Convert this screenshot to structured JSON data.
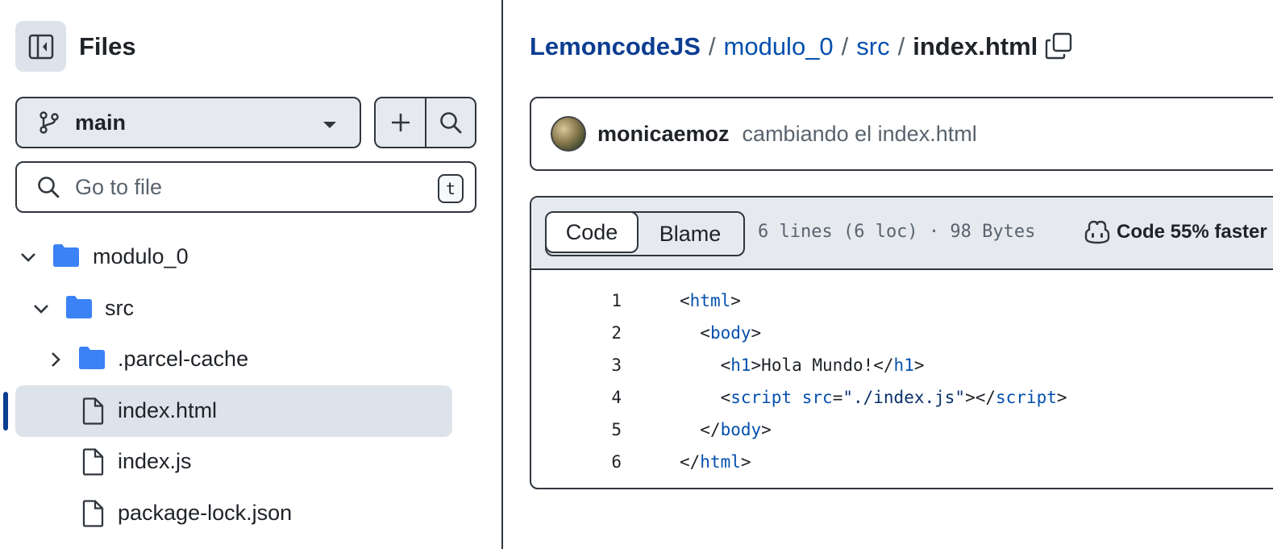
{
  "sidebar": {
    "title": "Files",
    "branch": "main",
    "search_placeholder": "Go to file",
    "search_shortcut": "t",
    "tree": [
      {
        "label": "modulo_0",
        "type": "folder",
        "expanded": true
      },
      {
        "label": "src",
        "type": "folder",
        "expanded": true
      },
      {
        "label": ".parcel-cache",
        "type": "folder",
        "expanded": false
      },
      {
        "label": "index.html",
        "type": "file",
        "active": true
      },
      {
        "label": "index.js",
        "type": "file"
      },
      {
        "label": "package-lock.json",
        "type": "file"
      }
    ]
  },
  "breadcrumb": {
    "repo": "LemoncodeJS",
    "dir1": "modulo_0",
    "dir2": "src",
    "file": "index.html",
    "separator": "/"
  },
  "commit": {
    "author": "monicaemoz",
    "message": "cambiando el index.html"
  },
  "file_header": {
    "tab_code": "Code",
    "tab_blame": "Blame",
    "meta": "6 lines (6 loc) · 98 Bytes",
    "copilot": "Code 55% faster"
  },
  "code_lines": [
    {
      "n": "1",
      "indent": "",
      "parts": [
        [
          "p",
          "<"
        ],
        [
          "t",
          "html"
        ],
        [
          "p",
          ">"
        ]
      ]
    },
    {
      "n": "2",
      "indent": "  ",
      "parts": [
        [
          "p",
          "<"
        ],
        [
          "t",
          "body"
        ],
        [
          "p",
          ">"
        ]
      ]
    },
    {
      "n": "3",
      "indent": "    ",
      "parts": [
        [
          "p",
          "<"
        ],
        [
          "t",
          "h1"
        ],
        [
          "p",
          ">Hola Mundo!</"
        ],
        [
          "t",
          "h1"
        ],
        [
          "p",
          ">"
        ]
      ]
    },
    {
      "n": "4",
      "indent": "    ",
      "parts": [
        [
          "p",
          "<"
        ],
        [
          "t",
          "script"
        ],
        [
          "p",
          " "
        ],
        [
          "a",
          "src"
        ],
        [
          "p",
          "="
        ],
        [
          "s",
          "\"./index.js\""
        ],
        [
          "p",
          "></"
        ],
        [
          "t",
          "script"
        ],
        [
          "p",
          ">"
        ]
      ]
    },
    {
      "n": "5",
      "indent": "  ",
      "parts": [
        [
          "p",
          "</"
        ],
        [
          "t",
          "body"
        ],
        [
          "p",
          ">"
        ]
      ]
    },
    {
      "n": "6",
      "indent": "",
      "parts": [
        [
          "p",
          "</"
        ],
        [
          "t",
          "html"
        ],
        [
          "p",
          ">"
        ]
      ]
    }
  ],
  "colors": {
    "link": "#0550ae",
    "active_marker": "#0b3d91",
    "folder_icon": "#3b82f6",
    "panel_bg": "#e6eaef"
  }
}
